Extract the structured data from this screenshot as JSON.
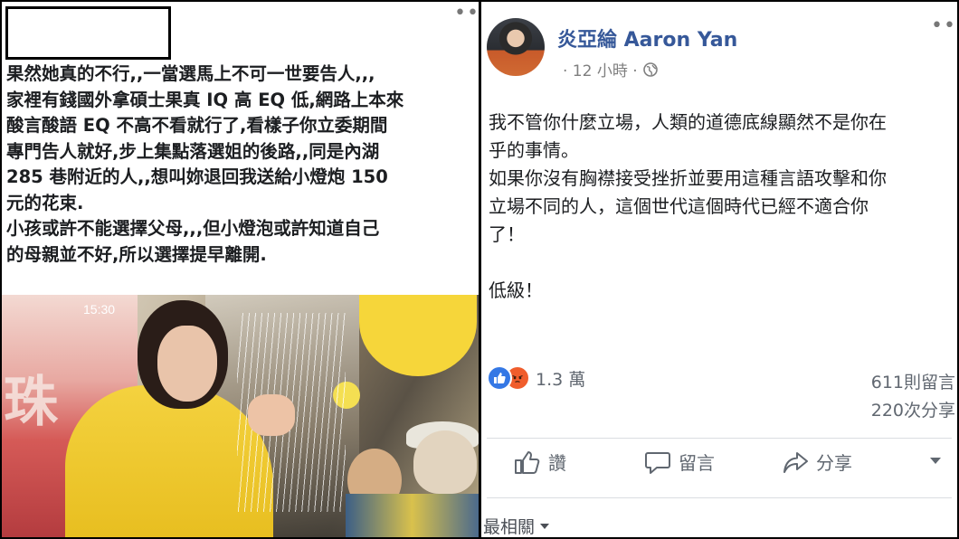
{
  "left_post": {
    "more_label": "•••",
    "lines": [
      "果然她真的不行,,一當選馬上不可一世要告人,,,",
      "家裡有錢國外拿碩士果真 IQ 高 EQ 低,網路上本來",
      "酸言酸語 EQ 不高不看就行了,看樣子你立委期間",
      "專門告人就好,步上集點落選姐的後路,,同是內湖",
      "285 巷附近的人,,想叫妳退回我送給小燈炮 150",
      "元的花束.",
      "小孩或許不能選擇父母,,,但小燈泡或許知道自己",
      "的母親並不好,所以選擇提早離開."
    ],
    "photo": {
      "poster_time": "15:30",
      "poster_line2": "",
      "poster_big": "珠"
    }
  },
  "right_post": {
    "author": "炎亞綸 Aaron Yan",
    "timestamp": "· 12 小時 ·",
    "more_label": "•••",
    "body": [
      "我不管你什麼立場，人類的道德底線顯然不是你在",
      "乎的事情。",
      "如果你沒有胸襟接受挫折並要用這種言語攻擊和你",
      "立場不同的人，這個世代這個時代已經不適合你",
      "了！",
      "",
      "低級！"
    ],
    "reactions_count": "1.3 萬",
    "comments_count": "611則留言",
    "shares_count": "220次分享",
    "actions": {
      "like": "讚",
      "comment": "留言",
      "share": "分享"
    },
    "sort_label": "最相關"
  },
  "colors": {
    "author_link": "#365899",
    "like_blue": "#3578e5",
    "angry_orange": "#f05d2c",
    "meta_gray": "#7f7f7f"
  }
}
